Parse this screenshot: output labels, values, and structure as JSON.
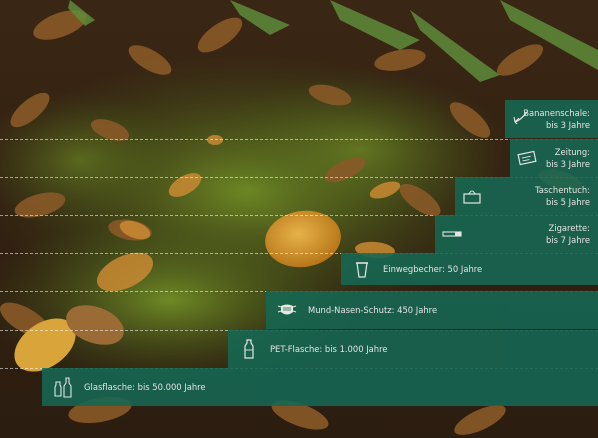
{
  "chart_data": {
    "type": "bar",
    "orientation": "horizontal",
    "value_unit": "Jahre",
    "scale": "log",
    "categories": [
      "Bananenschale",
      "Zeitung",
      "Taschentuch",
      "Zigarette",
      "Einwegbecher",
      "Mund-Nasen-Schutz",
      "PET-Flasche",
      "Glasflasche"
    ],
    "values": [
      3,
      3,
      5,
      7,
      50,
      450,
      1000,
      50000
    ],
    "labels": [
      {
        "line1": "Bananenschale:",
        "line2": "bis 3 Jahre",
        "icon": "banana-peel-icon"
      },
      {
        "line1": "Zeitung:",
        "line2": "bis 3 Jahre",
        "icon": "newspaper-icon"
      },
      {
        "line1": "Taschentuch:",
        "line2": "bis 5 Jahre",
        "icon": "tissue-box-icon"
      },
      {
        "line1": "Zigarette:",
        "line2": "bis 7 Jahre",
        "icon": "cigarette-icon"
      },
      {
        "line1": "Einwegbecher: 50 Jahre",
        "icon": "disposable-cup-icon"
      },
      {
        "line1": "Mund-Nasen-Schutz: 450 Jahre",
        "icon": "face-mask-icon"
      },
      {
        "line1": "PET-Flasche: bis 1.000 Jahre",
        "icon": "plastic-bottle-icon"
      },
      {
        "line1": "Glasflasche: bis 50.000 Jahre",
        "icon": "glass-bottle-icon"
      }
    ],
    "bar_color": "#166854",
    "background": "forest-floor-photo"
  }
}
